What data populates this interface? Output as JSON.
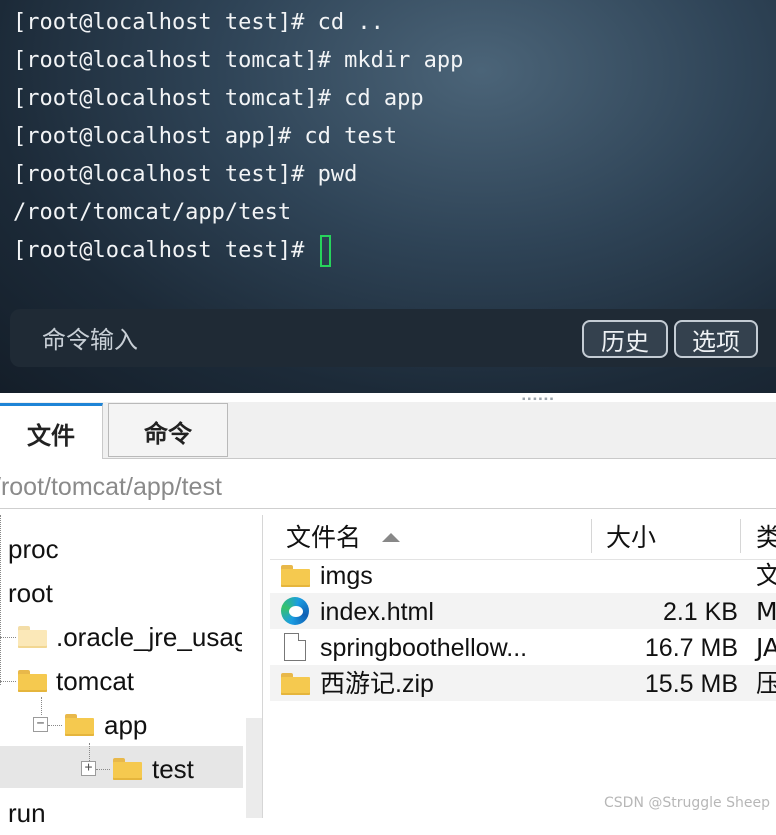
{
  "terminal": {
    "lines": [
      "[root@localhost test]# cd ..",
      "[root@localhost tomcat]# mkdir app",
      "[root@localhost tomcat]# cd app",
      "[root@localhost app]# cd test",
      "[root@localhost test]# pwd",
      "/root/tomcat/app/test",
      "[root@localhost test]# "
    ],
    "cursor_color": "#27d35c",
    "command_bar": {
      "placeholder": "命令输入",
      "history_label": "历史",
      "options_label": "选项"
    }
  },
  "tabs": [
    {
      "label": "文件",
      "active": true
    },
    {
      "label": "命令",
      "active": false
    }
  ],
  "path": "/root/tomcat/app/test",
  "tree": {
    "items": [
      {
        "label": "proc"
      },
      {
        "label": "root"
      },
      {
        "label": ".oracle_jre_usag"
      },
      {
        "label": "tomcat"
      },
      {
        "label": "app"
      },
      {
        "label": "test"
      },
      {
        "label": "run"
      }
    ]
  },
  "filelist": {
    "columns": {
      "name": "文件名",
      "size": "大小",
      "type": "类"
    },
    "rows": [
      {
        "name": "imgs",
        "size": "",
        "type": "文",
        "icon": "folder-icon"
      },
      {
        "name": "index.html",
        "size": "2.1 KB",
        "type": "M",
        "icon": "edge-browser-icon"
      },
      {
        "name": "springboothellow...",
        "size": "16.7 MB",
        "type": "JA",
        "icon": "file-icon"
      },
      {
        "name": "西游记.zip",
        "size": "15.5 MB",
        "type": "压",
        "icon": "zip-folder-icon"
      }
    ]
  },
  "watermark": "CSDN @Struggle Sheep",
  "colors": {
    "accent_tab": "#1e84d6",
    "folder": "#f5c94f"
  }
}
